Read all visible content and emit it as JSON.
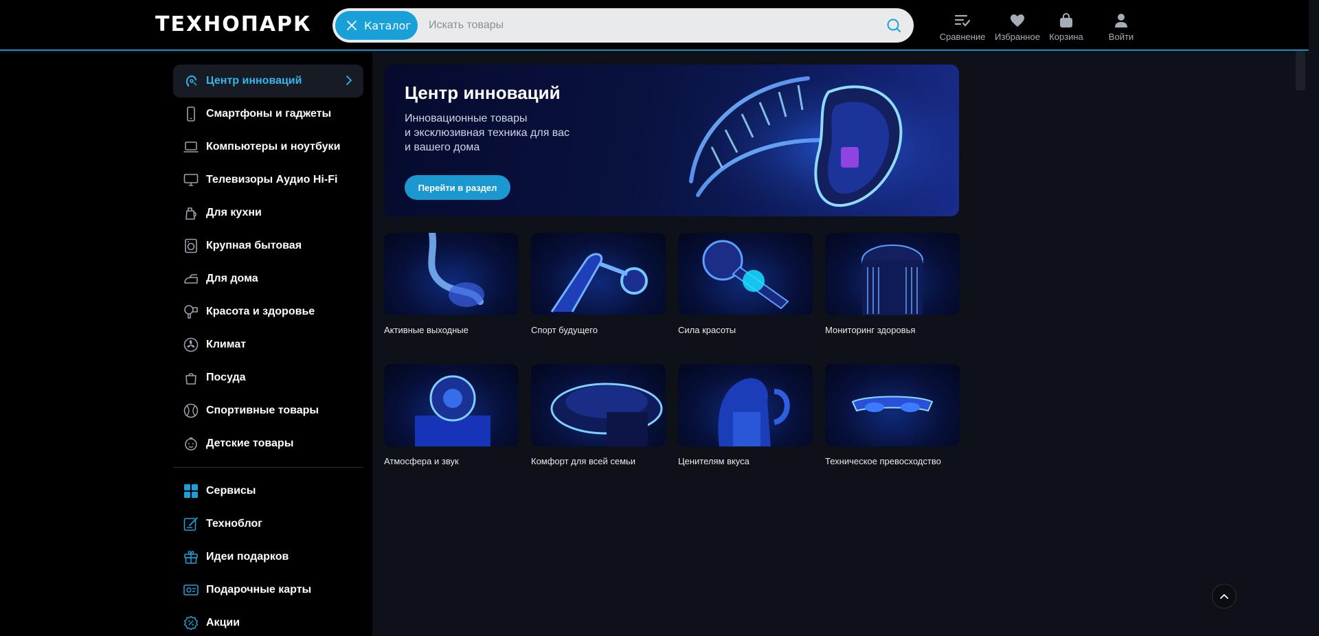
{
  "header": {
    "logo_text": "ТЕХНОПАРК",
    "catalog_label": "Каталог",
    "search_placeholder": "Искать товары",
    "actions": {
      "compare": "Сравнение",
      "favorites": "Избранное",
      "cart": "Корзина",
      "login": "Войти"
    }
  },
  "sidebar": {
    "categories": [
      {
        "label": "Центр инноваций",
        "icon": "innovation-icon"
      },
      {
        "label": "Смартфоны и гаджеты",
        "icon": "smartphone-icon"
      },
      {
        "label": "Компьютеры и ноутбуки",
        "icon": "laptop-icon"
      },
      {
        "label": "Телевизоры Аудио Hi-Fi",
        "icon": "tv-icon"
      },
      {
        "label": "Для кухни",
        "icon": "kettle-icon"
      },
      {
        "label": "Крупная бытовая",
        "icon": "washing-machine-icon"
      },
      {
        "label": "Для дома",
        "icon": "iron-icon"
      },
      {
        "label": "Красота и здоровье",
        "icon": "hairdryer-icon"
      },
      {
        "label": "Климат",
        "icon": "fan-icon"
      },
      {
        "label": "Посуда",
        "icon": "pot-icon"
      },
      {
        "label": "Спортивные товары",
        "icon": "ball-icon"
      },
      {
        "label": "Детские товары",
        "icon": "child-icon"
      }
    ],
    "extras": [
      {
        "label": "Сервисы",
        "icon": "services-icon"
      },
      {
        "label": "Техноблог",
        "icon": "blog-icon"
      },
      {
        "label": "Идеи подарков",
        "icon": "gift-icon"
      },
      {
        "label": "Подарочные карты",
        "icon": "gift-card-icon"
      },
      {
        "label": "Акции",
        "icon": "promo-icon"
      }
    ]
  },
  "banner": {
    "title": "Центр инноваций",
    "desc_line1": "Инновационные товары",
    "desc_line2": "и эксклюзивная техника для вас",
    "desc_line3": "и вашего дома",
    "button": "Перейти в раздел"
  },
  "tiles": [
    {
      "caption": "Активные выходные"
    },
    {
      "caption": "Спорт будущего"
    },
    {
      "caption": "Сила красоты"
    },
    {
      "caption": "Мониторинг здоровья"
    },
    {
      "caption": "Атмосфера и звук"
    },
    {
      "caption": "Комфорт для всей семьи"
    },
    {
      "caption": "Ценителям вкуса"
    },
    {
      "caption": "Техническое превосходство"
    }
  ],
  "colors": {
    "accent": "#1aa0d8",
    "active_text": "#33b6ea",
    "background": "#0e1117"
  }
}
